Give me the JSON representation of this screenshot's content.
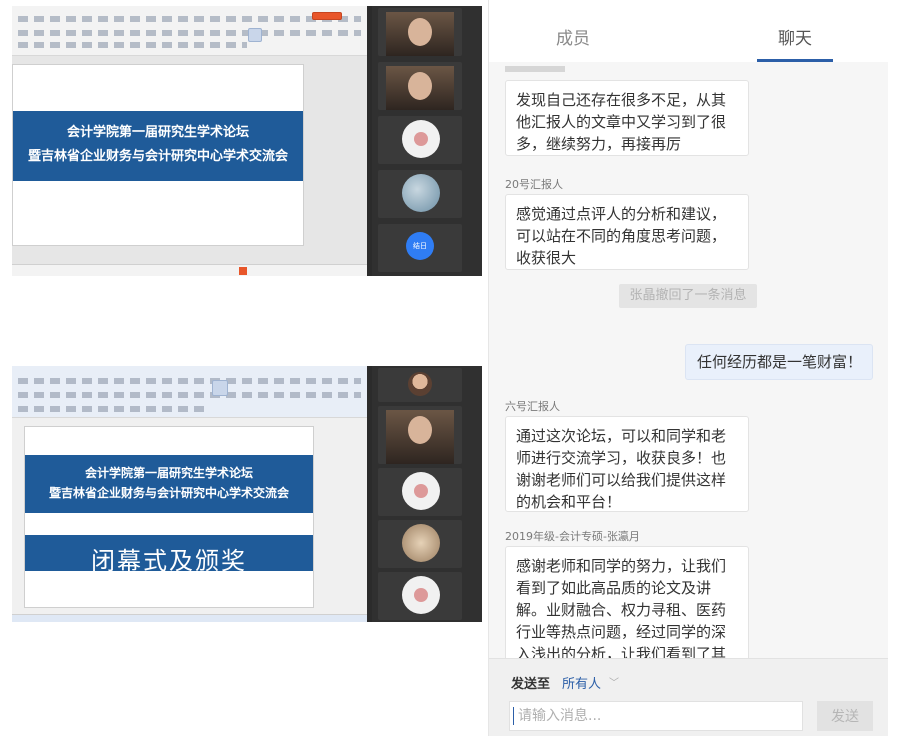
{
  "screen1": {
    "banner_line1": "会计学院第一届研究生学术论坛",
    "banner_line2": "暨吉林省企业财务与会计研究中心学术交流会",
    "join_button": "结日"
  },
  "screen2": {
    "banner_line1": "会计学院第一届研究生学术论坛",
    "banner_line2": "暨吉林省企业财务与会计研究中心学术交流会",
    "title": "闭幕式及颁奖"
  },
  "chat": {
    "tabs": {
      "members": "成员",
      "members_count": "",
      "chat": "聊天"
    },
    "messages": [
      {
        "sender": "",
        "text": "发现自己还存在很多不足，从其\n他汇报人的文章中又学习到了很\n多，继续努力，再接再厉"
      },
      {
        "sender": "20号汇报人",
        "text": "感觉通过点评人的分析和建议，\n可以站在不同的角度思考问题，\n收获很大"
      },
      {
        "sender": "六号汇报人",
        "text": "通过这次论坛，可以和同学和老\n师进行交流学习，收获良多！也\n谢谢老师们可以给我们提供这样\n的机会和平台！"
      },
      {
        "sender": "2019年级-会计专硕-张瀛月",
        "text": "感谢老师和同学的努力，让我们\n看到了如此高品质的论文及讲\n解。业财融合、权力寻租、医药\n行业等热点问题，经过同学的深\n入浅出的分析，让我们看到了其"
      }
    ],
    "recall_notice": "张晶撤回了一条消息",
    "own_message": "任何经历都是一笔财富！",
    "composer": {
      "send_to_label": "发送至",
      "send_to_value": "所有人",
      "placeholder": "请输入消息...",
      "send_button": "发送"
    }
  },
  "colors": {
    "banner": "#1f5b99",
    "accent": "#2c5fa8",
    "join": "#2f7df4"
  }
}
